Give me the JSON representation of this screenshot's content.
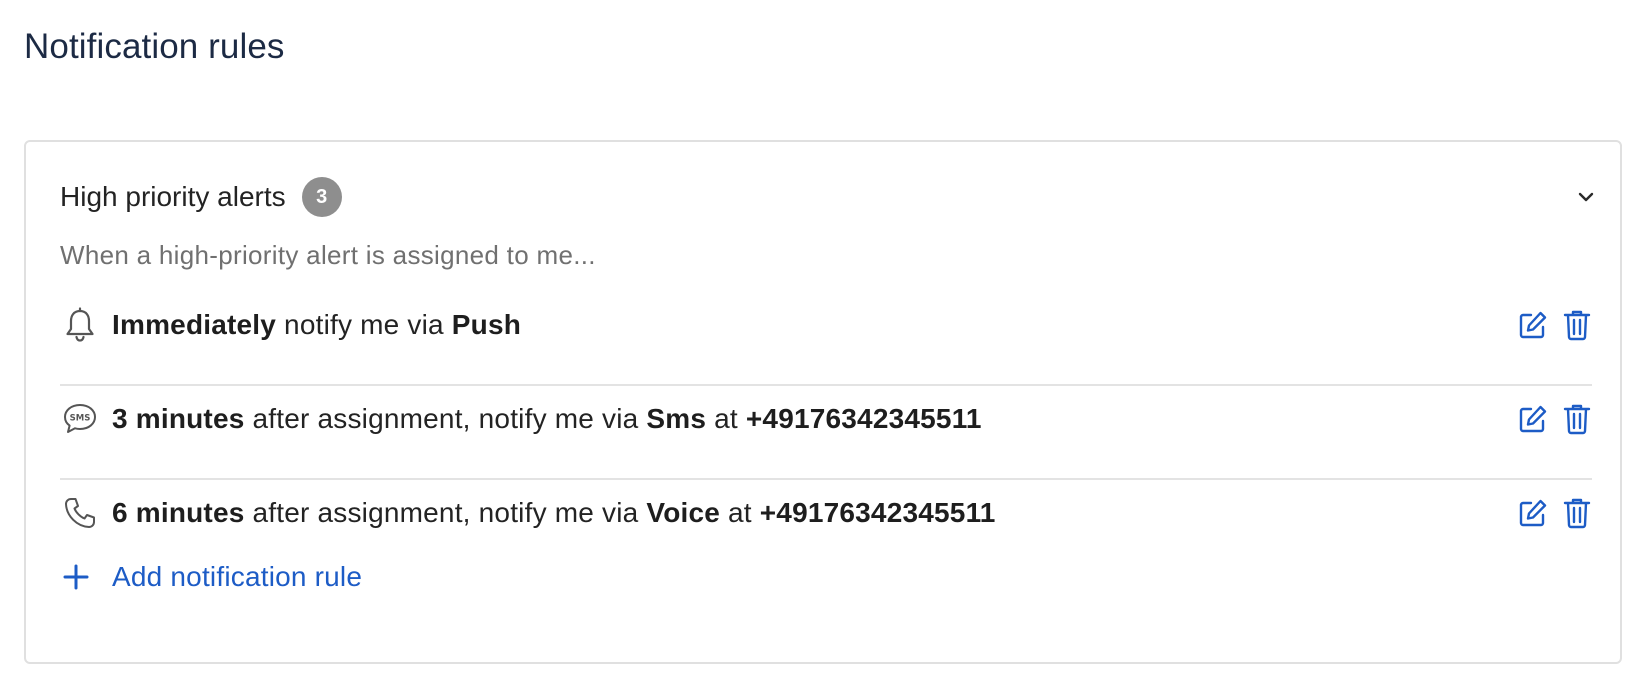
{
  "page": {
    "title": "Notification rules"
  },
  "section": {
    "title": "High priority alerts",
    "count": "3",
    "description": "When a high-priority alert is assigned to me...",
    "collapse_icon": "chevron-down-icon"
  },
  "rules": [
    {
      "icon": "bell-icon",
      "timing": "Immediately",
      "text_1": " notify me via ",
      "channel": "Push",
      "text_2": "",
      "contact": ""
    },
    {
      "icon": "sms-icon",
      "timing": "3 minutes",
      "text_1": " after assignment, notify me via ",
      "channel": "Sms",
      "text_2": " at ",
      "contact": "+49176342345511"
    },
    {
      "icon": "phone-icon",
      "timing": "6 minutes",
      "text_1": " after assignment, notify me via ",
      "channel": "Voice",
      "text_2": " at ",
      "contact": "+49176342345511"
    }
  ],
  "actions": {
    "edit_icon": "edit-icon",
    "delete_icon": "trash-icon"
  },
  "add_rule": {
    "label": "Add notification rule",
    "icon": "plus-icon"
  },
  "colors": {
    "accent": "#1d5cc6",
    "badge": "#8e8e8e",
    "title": "#1c2a44",
    "muted": "#707070",
    "border": "#e0e0e0"
  }
}
